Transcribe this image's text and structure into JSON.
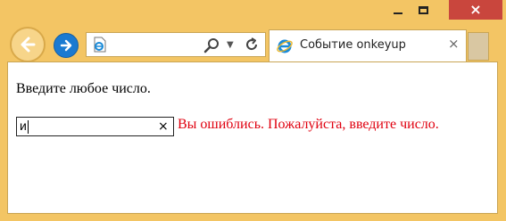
{
  "window": {
    "controls": {
      "minimize": "minimize",
      "maximize": "maximize",
      "close": "×"
    }
  },
  "nav": {
    "back_icon": "back-arrow-icon",
    "forward_icon": "forward-arrow-icon"
  },
  "address_bar": {
    "url": "",
    "site_icon": "ie-page-icon",
    "search_icon": "search-icon",
    "dropdown_icon": "chevron-down-icon",
    "refresh_icon": "refresh-icon"
  },
  "tab": {
    "title": "Событие onkeyup",
    "close": "×"
  },
  "page": {
    "prompt": "Введите любое число.",
    "input_value": "и",
    "input_clear": "×",
    "error_message": "Вы ошиблись. Пожалуйста, введите число.",
    "error_color": "#e0000f"
  },
  "colors": {
    "frame": "#f3c564",
    "close_button": "#c9463d",
    "forward_button": "#1a7ad1"
  }
}
